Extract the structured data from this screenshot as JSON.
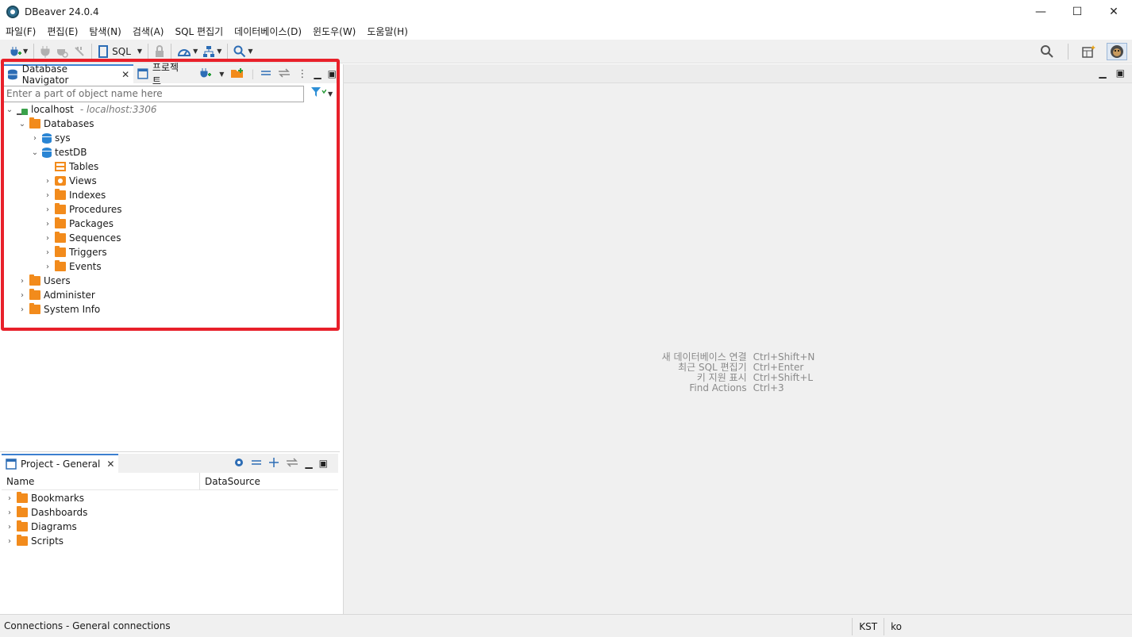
{
  "window": {
    "title": "DBeaver 24.0.4",
    "minimize": "—",
    "maximize": "☐",
    "close": "✕"
  },
  "menu": [
    "파일(F)",
    "편집(E)",
    "탐색(N)",
    "검색(A)",
    "SQL 편집기",
    "데이터베이스(D)",
    "윈도우(W)",
    "도움말(H)"
  ],
  "toolbar": {
    "sql_label": "SQL"
  },
  "navigator": {
    "tab_label": "Database Navigator",
    "tab2_label": "프로젝트",
    "filter_placeholder": "Enter a part of object name here",
    "tree": {
      "connection": {
        "label": "localhost",
        "detail": "- localhost:3306"
      },
      "databases": "Databases",
      "sys": "sys",
      "testdb": "testDB",
      "children": [
        "Tables",
        "Views",
        "Indexes",
        "Procedures",
        "Packages",
        "Sequences",
        "Triggers",
        "Events"
      ],
      "users": "Users",
      "administer": "Administer",
      "system_info": "System Info"
    }
  },
  "project": {
    "tab_label": "Project - General",
    "columns": [
      "Name",
      "DataSource"
    ],
    "items": [
      "Bookmarks",
      "Dashboards",
      "Diagrams",
      "Scripts"
    ]
  },
  "editor_hints": [
    {
      "action": "새 데이터베이스 연결",
      "shortcut": "Ctrl+Shift+N"
    },
    {
      "action": "최근 SQL 편집기",
      "shortcut": "Ctrl+Enter"
    },
    {
      "action": "키 지원 표시",
      "shortcut": "Ctrl+Shift+L"
    },
    {
      "action": "Find Actions",
      "shortcut": "Ctrl+3"
    }
  ],
  "status": {
    "text": "Connections - General connections",
    "timezone": "KST",
    "locale": "ko"
  },
  "colors": {
    "highlight": "#e8202a",
    "folder": "#f28b1c",
    "accent": "#2d6db5"
  }
}
